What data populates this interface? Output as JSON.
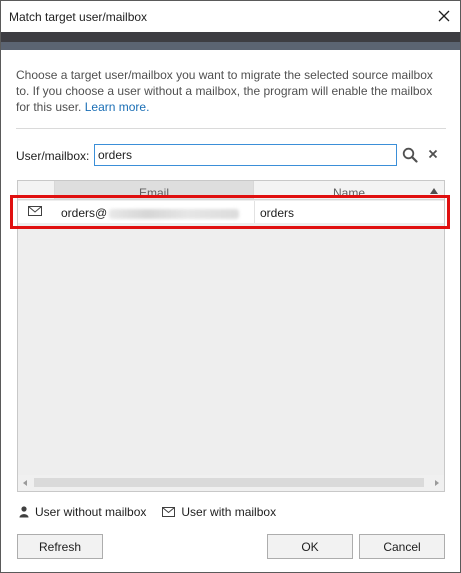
{
  "window": {
    "title": "Match target user/mailbox",
    "close_icon": "close-icon"
  },
  "description": {
    "text": "Choose a target user/mailbox you want to migrate the selected source mailbox to. If you choose a user without a mailbox, the program will enable the mailbox for this user.",
    "link": "Learn more."
  },
  "search": {
    "label": "User/mailbox:",
    "value": "orders",
    "search_icon": "search-icon",
    "clear_icon": "clear-icon"
  },
  "grid": {
    "columns": [
      "",
      "Email",
      "Name"
    ],
    "sort": "Name ascending",
    "rows": [
      {
        "icon": "mail-icon",
        "email_prefix": "orders@",
        "email_domain_blurred": true,
        "name": "orders"
      }
    ]
  },
  "legend": {
    "without_mailbox": "User without mailbox",
    "with_mailbox": "User with mailbox"
  },
  "buttons": {
    "refresh": "Refresh",
    "ok": "OK",
    "cancel": "Cancel"
  },
  "colors": {
    "header_band": "#3d3d42",
    "link": "#1a6eb5",
    "highlight": "#e01010",
    "input_focus": "#3b8fd8"
  }
}
